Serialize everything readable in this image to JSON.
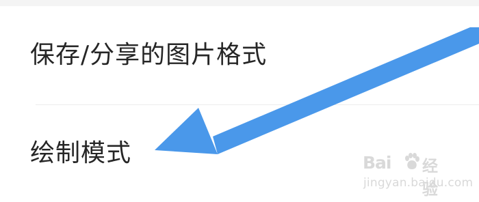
{
  "settings": {
    "items": [
      {
        "label": "保存/分享的图片格式"
      },
      {
        "label": "绘制模式"
      }
    ]
  },
  "annotation": {
    "icon": "blue-arrow-icon",
    "color": "#4a98ea"
  },
  "watermark": {
    "logo": "Bai",
    "paw_icon": "paw-icon",
    "product": "经验",
    "site": "jingyan.baidu.com"
  }
}
